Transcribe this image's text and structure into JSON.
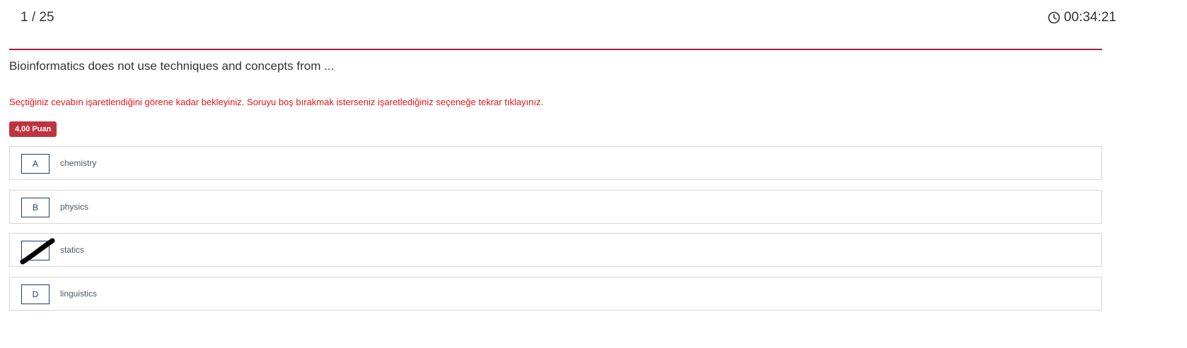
{
  "header": {
    "question_counter": "1 / 25",
    "timer": "00:34:21",
    "timer_icon": "clock-icon",
    "accent_color": "#a31f45"
  },
  "question": {
    "text": "Bioinformatics does not use techniques and concepts from ...",
    "warning": "Seçtiğiniz cevabın işaretlendiğini görene kadar bekleyiniz. Soruyu boş bırakmak isterseniz işaretlediğiniz seçeneğe tekrar tıklayınız.",
    "warning_color": "#e8141b",
    "points": "4,00 Puan",
    "points_color": "#c0343f"
  },
  "options": [
    {
      "letter": "A",
      "text": "chemistry",
      "selected": false
    },
    {
      "letter": "B",
      "text": "physics",
      "selected": false
    },
    {
      "letter": "C",
      "text": "statics",
      "selected": true,
      "mark": "strike-through-mark"
    },
    {
      "letter": "D",
      "text": "linguistics",
      "selected": false
    }
  ]
}
